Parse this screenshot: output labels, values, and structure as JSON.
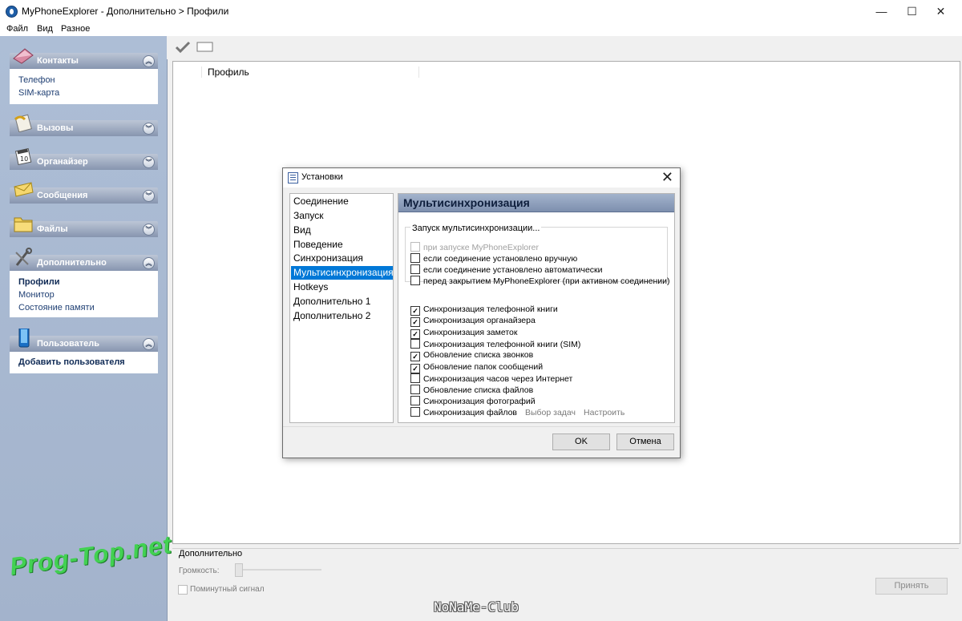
{
  "window": {
    "title": "MyPhoneExplorer -  Дополнительно > Профили",
    "minimize": "—",
    "maximize": "☐",
    "close": "✕"
  },
  "menu": [
    "Файл",
    "Вид",
    "Разное"
  ],
  "sidebar": {
    "groups": [
      {
        "label": "Контакты",
        "icon": "contacts-icon",
        "chevron": "up",
        "items": [
          "Телефон",
          "SIM-карта"
        ]
      },
      {
        "label": "Вызовы",
        "icon": "calls-icon",
        "chevron": "down",
        "items": []
      },
      {
        "label": "Органайзер",
        "icon": "organizer-icon",
        "chevron": "down",
        "items": []
      },
      {
        "label": "Сообщения",
        "icon": "messages-icon",
        "chevron": "down",
        "items": []
      },
      {
        "label": "Файлы",
        "icon": "files-icon",
        "chevron": "down",
        "items": []
      },
      {
        "label": "Дополнительно",
        "icon": "tools-icon",
        "chevron": "up",
        "items": [
          "Профили",
          "Монитор",
          "Состояние памяти"
        ],
        "active": "Профили"
      },
      {
        "label": "Пользователь",
        "icon": "phone-icon",
        "chevron": "up",
        "items": [
          "Добавить пользователя"
        ],
        "active": "Добавить пользователя"
      }
    ]
  },
  "toolbar": {
    "icons": [
      "checkmark-icon",
      "rectangle-icon"
    ]
  },
  "main": {
    "column_header": "Профиль"
  },
  "bottom_panel": {
    "title": "Дополнительно",
    "volume_label": "Громкость:",
    "minute_beep_label": "Поминутный сигнал",
    "apply_button": "Принять"
  },
  "watermarks": {
    "left": "Prog-Top.net",
    "bottom": "NoNaMe-Club"
  },
  "dialog": {
    "title": "Установки",
    "close": "✕",
    "nav": [
      "Соединение",
      "Запуск",
      "Вид",
      "Поведение",
      "Синхронизация",
      "Мультисинхронизация",
      "Hotkeys",
      "Дополнительно 1",
      "Дополнительно 2"
    ],
    "nav_selected": "Мультисинхронизация",
    "pane_title": "Мультисинхронизация",
    "group_label": "Запуск мультисинхронизации...",
    "launch_options": [
      {
        "label": "при запуске MyPhoneExplorer",
        "checked": false,
        "disabled": true
      },
      {
        "label": "если соединение установлено вручную",
        "checked": false,
        "disabled": false
      },
      {
        "label": "если соединение установлено автоматически",
        "checked": false,
        "disabled": false
      },
      {
        "label": "перед закрытием MyPhoneExplorer (при активном соединении)",
        "checked": false,
        "disabled": false
      }
    ],
    "sync_options": [
      {
        "label": "Синхронизация телефонной книги",
        "checked": true
      },
      {
        "label": "Синхронизация органайзера",
        "checked": true
      },
      {
        "label": "Синхронизация заметок",
        "checked": true
      },
      {
        "label": "Синхронизация телефонной книги (SIM)",
        "checked": false
      },
      {
        "label": "Обновление списка звонков",
        "checked": true
      },
      {
        "label": "Обновление папок сообщений",
        "checked": true
      },
      {
        "label": "Синхронизация часов через Интернет",
        "checked": false
      },
      {
        "label": "Обновление списка файлов",
        "checked": false
      },
      {
        "label": "Синхронизация фотографий",
        "checked": false
      },
      {
        "label": "Синхронизация файлов",
        "checked": false,
        "links": [
          "Выбор задач",
          "Настроить"
        ]
      }
    ],
    "ok_button": "OK",
    "cancel_button": "Отмена"
  }
}
